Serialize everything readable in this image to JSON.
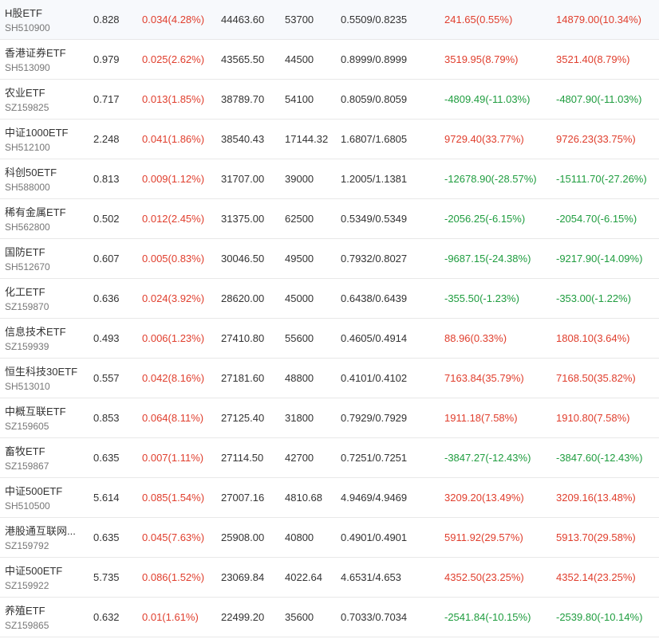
{
  "colors": {
    "up": "#e03e2d",
    "down": "#1f9d3f",
    "text": "#333333",
    "code": "#777777",
    "divider": "#e8e8e8"
  },
  "rows": [
    {
      "name": "H股ETF",
      "code": "SH510900",
      "price": "0.828",
      "change": "0.034(4.28%)",
      "amount": "44463.60",
      "volume": "53700",
      "range": "0.5509/0.8235",
      "flow1": "241.65(0.55%)",
      "flow2": "14879.00(10.34%)",
      "change_dir": "up",
      "flow1_dir": "up",
      "flow2_dir": "up"
    },
    {
      "name": "香港证券ETF",
      "code": "SH513090",
      "price": "0.979",
      "change": "0.025(2.62%)",
      "amount": "43565.50",
      "volume": "44500",
      "range": "0.8999/0.8999",
      "flow1": "3519.95(8.79%)",
      "flow2": "3521.40(8.79%)",
      "change_dir": "up",
      "flow1_dir": "up",
      "flow2_dir": "up"
    },
    {
      "name": "农业ETF",
      "code": "SZ159825",
      "price": "0.717",
      "change": "0.013(1.85%)",
      "amount": "38789.70",
      "volume": "54100",
      "range": "0.8059/0.8059",
      "flow1": "-4809.49(-11.03%)",
      "flow2": "-4807.90(-11.03%)",
      "change_dir": "up",
      "flow1_dir": "down",
      "flow2_dir": "down"
    },
    {
      "name": "中证1000ETF",
      "code": "SH512100",
      "price": "2.248",
      "change": "0.041(1.86%)",
      "amount": "38540.43",
      "volume": "17144.32",
      "range": "1.6807/1.6805",
      "flow1": "9729.40(33.77%)",
      "flow2": "9726.23(33.75%)",
      "change_dir": "up",
      "flow1_dir": "up",
      "flow2_dir": "up"
    },
    {
      "name": "科创50ETF",
      "code": "SH588000",
      "price": "0.813",
      "change": "0.009(1.12%)",
      "amount": "31707.00",
      "volume": "39000",
      "range": "1.2005/1.1381",
      "flow1": "-12678.90(-28.57%)",
      "flow2": "-15111.70(-27.26%)",
      "change_dir": "up",
      "flow1_dir": "down",
      "flow2_dir": "down"
    },
    {
      "name": "稀有金属ETF",
      "code": "SH562800",
      "price": "0.502",
      "change": "0.012(2.45%)",
      "amount": "31375.00",
      "volume": "62500",
      "range": "0.5349/0.5349",
      "flow1": "-2056.25(-6.15%)",
      "flow2": "-2054.70(-6.15%)",
      "change_dir": "up",
      "flow1_dir": "down",
      "flow2_dir": "down"
    },
    {
      "name": "国防ETF",
      "code": "SH512670",
      "price": "0.607",
      "change": "0.005(0.83%)",
      "amount": "30046.50",
      "volume": "49500",
      "range": "0.7932/0.8027",
      "flow1": "-9687.15(-24.38%)",
      "flow2": "-9217.90(-14.09%)",
      "change_dir": "up",
      "flow1_dir": "down",
      "flow2_dir": "down"
    },
    {
      "name": "化工ETF",
      "code": "SZ159870",
      "price": "0.636",
      "change": "0.024(3.92%)",
      "amount": "28620.00",
      "volume": "45000",
      "range": "0.6438/0.6439",
      "flow1": "-355.50(-1.23%)",
      "flow2": "-353.00(-1.22%)",
      "change_dir": "up",
      "flow1_dir": "down",
      "flow2_dir": "down"
    },
    {
      "name": "信息技术ETF",
      "code": "SZ159939",
      "price": "0.493",
      "change": "0.006(1.23%)",
      "amount": "27410.80",
      "volume": "55600",
      "range": "0.4605/0.4914",
      "flow1": "88.96(0.33%)",
      "flow2": "1808.10(3.64%)",
      "change_dir": "up",
      "flow1_dir": "up",
      "flow2_dir": "up"
    },
    {
      "name": "恒生科技30ETF",
      "code": "SH513010",
      "price": "0.557",
      "change": "0.042(8.16%)",
      "amount": "27181.60",
      "volume": "48800",
      "range": "0.4101/0.4102",
      "flow1": "7163.84(35.79%)",
      "flow2": "7168.50(35.82%)",
      "change_dir": "up",
      "flow1_dir": "up",
      "flow2_dir": "up"
    },
    {
      "name": "中概互联ETF",
      "code": "SZ159605",
      "price": "0.853",
      "change": "0.064(8.11%)",
      "amount": "27125.40",
      "volume": "31800",
      "range": "0.7929/0.7929",
      "flow1": "1911.18(7.58%)",
      "flow2": "1910.80(7.58%)",
      "change_dir": "up",
      "flow1_dir": "up",
      "flow2_dir": "up"
    },
    {
      "name": "畜牧ETF",
      "code": "SZ159867",
      "price": "0.635",
      "change": "0.007(1.11%)",
      "amount": "27114.50",
      "volume": "42700",
      "range": "0.7251/0.7251",
      "flow1": "-3847.27(-12.43%)",
      "flow2": "-3847.60(-12.43%)",
      "change_dir": "up",
      "flow1_dir": "down",
      "flow2_dir": "down"
    },
    {
      "name": "中证500ETF",
      "code": "SH510500",
      "price": "5.614",
      "change": "0.085(1.54%)",
      "amount": "27007.16",
      "volume": "4810.68",
      "range": "4.9469/4.9469",
      "flow1": "3209.20(13.49%)",
      "flow2": "3209.16(13.48%)",
      "change_dir": "up",
      "flow1_dir": "up",
      "flow2_dir": "up"
    },
    {
      "name": "港股通互联网...",
      "code": "SZ159792",
      "price": "0.635",
      "change": "0.045(7.63%)",
      "amount": "25908.00",
      "volume": "40800",
      "range": "0.4901/0.4901",
      "flow1": "5911.92(29.57%)",
      "flow2": "5913.70(29.58%)",
      "change_dir": "up",
      "flow1_dir": "up",
      "flow2_dir": "up"
    },
    {
      "name": "中证500ETF",
      "code": "SZ159922",
      "price": "5.735",
      "change": "0.086(1.52%)",
      "amount": "23069.84",
      "volume": "4022.64",
      "range": "4.6531/4.653",
      "flow1": "4352.50(23.25%)",
      "flow2": "4352.14(23.25%)",
      "change_dir": "up",
      "flow1_dir": "up",
      "flow2_dir": "up"
    },
    {
      "name": "养殖ETF",
      "code": "SZ159865",
      "price": "0.632",
      "change": "0.01(1.61%)",
      "amount": "22499.20",
      "volume": "35600",
      "range": "0.7033/0.7034",
      "flow1": "-2541.84(-10.15%)",
      "flow2": "-2539.80(-10.14%)",
      "change_dir": "up",
      "flow1_dir": "down",
      "flow2_dir": "down"
    }
  ]
}
